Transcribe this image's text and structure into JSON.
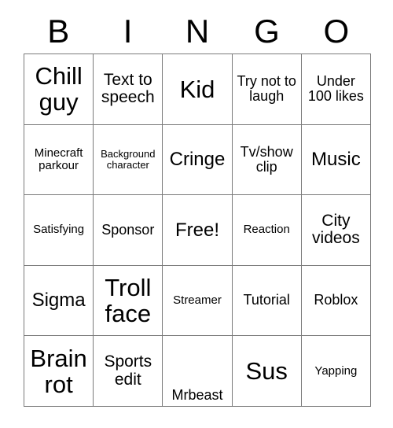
{
  "card": {
    "title": "BINGO",
    "header_letters": [
      "B",
      "I",
      "N",
      "G",
      "O"
    ],
    "grid_line_color": "#7a7a7a",
    "text_color": "#000000",
    "background_color": "#ffffff",
    "rows": 5,
    "columns": 5,
    "free_space": {
      "row": 3,
      "column": 3,
      "label": "Free!"
    },
    "cells": [
      [
        {
          "label": "Chill guy",
          "size": "xl",
          "valign": "center"
        },
        {
          "label": "Text to speech",
          "size": "md",
          "valign": "center"
        },
        {
          "label": "Kid",
          "size": "xl",
          "valign": "center"
        },
        {
          "label": "Try not to laugh",
          "size": "sm",
          "valign": "center"
        },
        {
          "label": "Under 100 likes",
          "size": "sm",
          "valign": "center"
        }
      ],
      [
        {
          "label": "Minecraft parkour",
          "size": "xs",
          "valign": "center"
        },
        {
          "label": "Background character",
          "size": "xxs",
          "valign": "center"
        },
        {
          "label": "Cringe",
          "size": "lg",
          "valign": "center"
        },
        {
          "label": "Tv/show clip",
          "size": "sm",
          "valign": "center"
        },
        {
          "label": "Music",
          "size": "lg",
          "valign": "center"
        }
      ],
      [
        {
          "label": "Satisfying",
          "size": "xs",
          "valign": "center"
        },
        {
          "label": "Sponsor",
          "size": "sm",
          "valign": "center"
        },
        {
          "label": "Free!",
          "size": "lg",
          "valign": "center"
        },
        {
          "label": "Reaction",
          "size": "xs",
          "valign": "center"
        },
        {
          "label": "City videos",
          "size": "md",
          "valign": "center"
        }
      ],
      [
        {
          "label": "Sigma",
          "size": "lg",
          "valign": "center"
        },
        {
          "label": "Troll face",
          "size": "xl",
          "valign": "center"
        },
        {
          "label": "Streamer",
          "size": "xs",
          "valign": "center"
        },
        {
          "label": "Tutorial",
          "size": "sm",
          "valign": "center"
        },
        {
          "label": "Roblox",
          "size": "sm",
          "valign": "center"
        }
      ],
      [
        {
          "label": "Brain rot",
          "size": "xl",
          "valign": "center"
        },
        {
          "label": "Sports edit",
          "size": "md",
          "valign": "center"
        },
        {
          "label": "Mrbeast",
          "size": "sm",
          "valign": "bottom"
        },
        {
          "label": "Sus",
          "size": "xl",
          "valign": "center"
        },
        {
          "label": "Yapping",
          "size": "xs",
          "valign": "center"
        }
      ]
    ]
  }
}
